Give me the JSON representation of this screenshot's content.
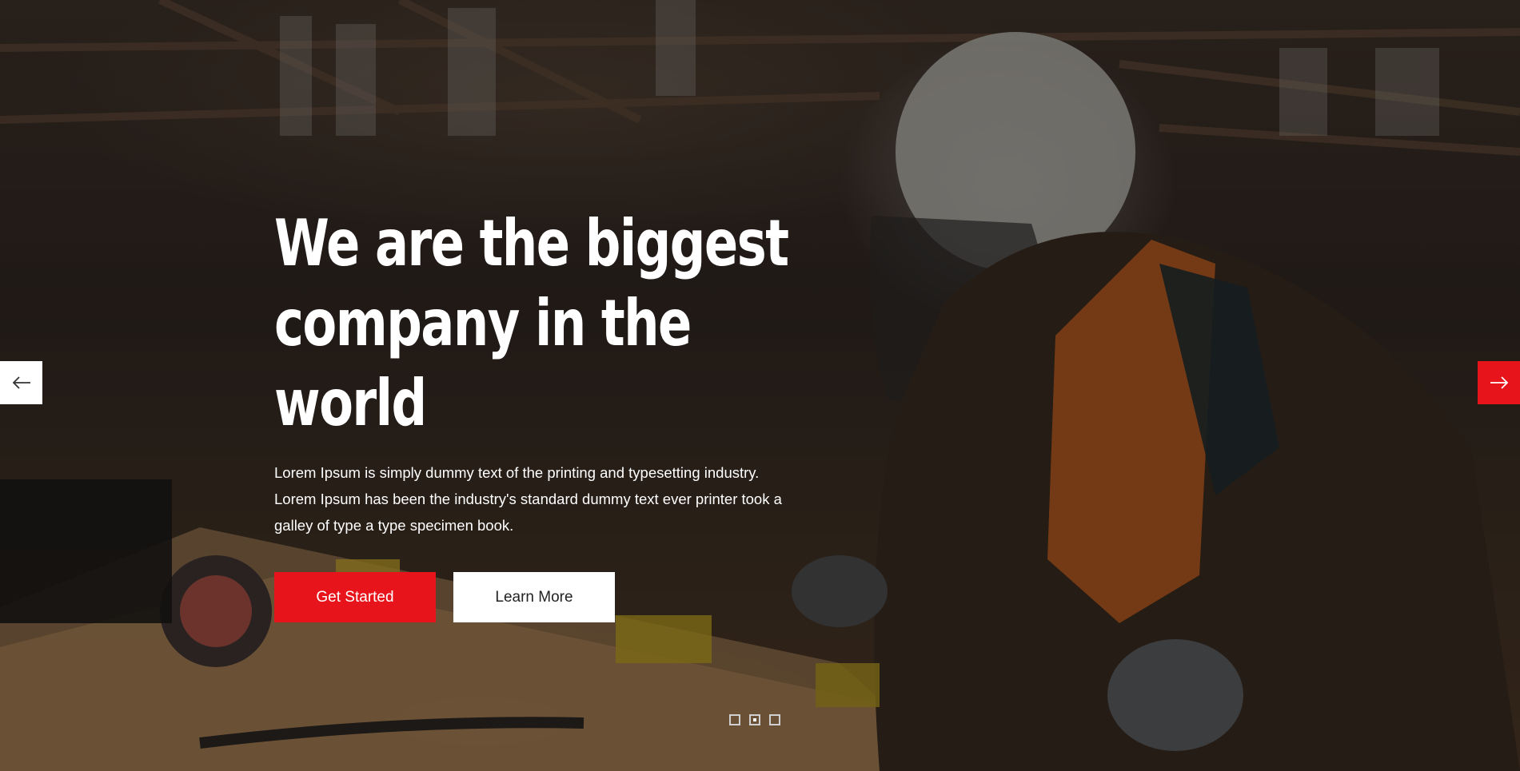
{
  "hero": {
    "headline_line1": "We are the biggest",
    "headline_line2": "company in the world",
    "description_line1": "Lorem Ipsum is simply dummy text of the printing and typesetting industry.",
    "description_line2": "Lorem Ipsum has been the industry's standard dummy text ever printer took a",
    "description_line3": "galley of type a type specimen book.",
    "primary_button": "Get Started",
    "secondary_button": "Learn More"
  },
  "slider": {
    "prev_icon": "arrow-left-icon",
    "next_icon": "arrow-right-icon",
    "dots": 3,
    "active_dot": 2
  },
  "colors": {
    "accent": "#e8141c",
    "text": "#ffffff"
  }
}
